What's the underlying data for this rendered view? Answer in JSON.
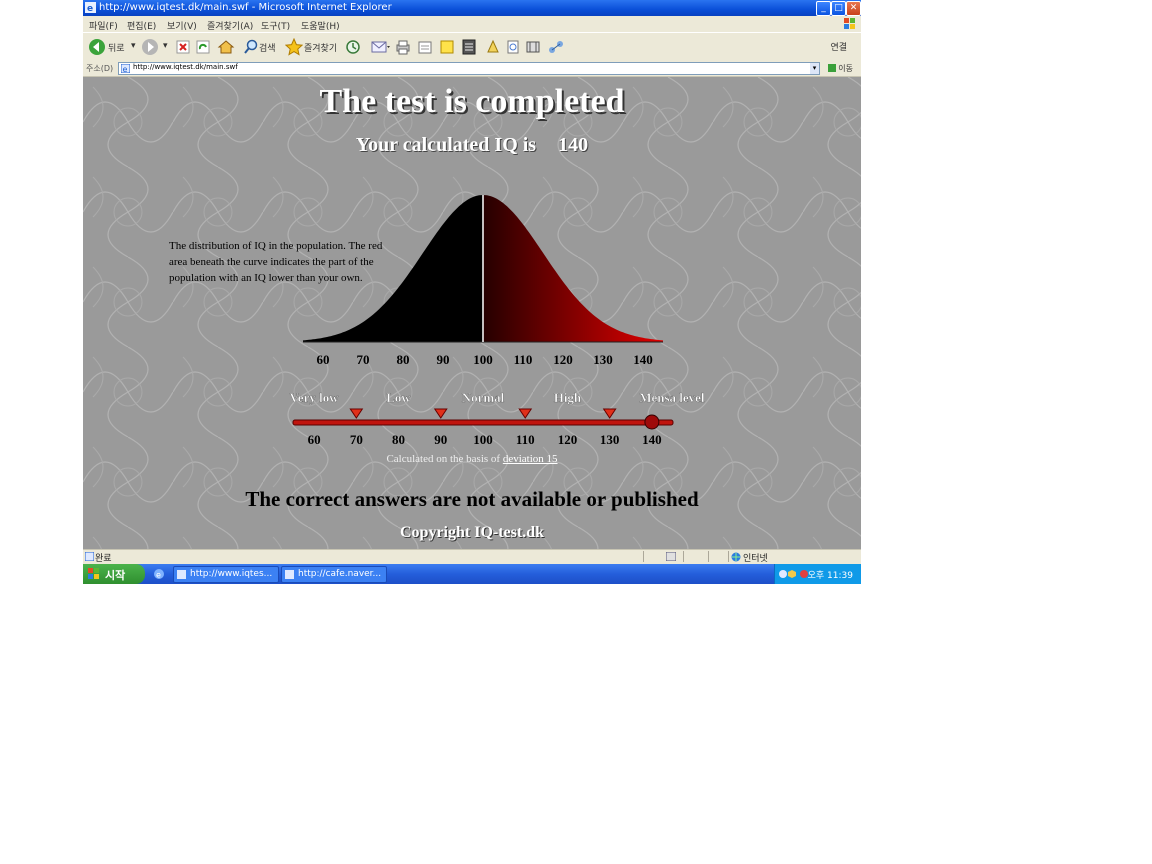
{
  "window": {
    "title": "http://www.iqtest.dk/main.swf - Microsoft Internet Explorer",
    "controls": [
      "_",
      "□",
      "✕"
    ]
  },
  "menu": [
    "파일(F)",
    "편집(E)",
    "보기(V)",
    "즐겨찾기(A)",
    "도구(T)",
    "도움말(H)"
  ],
  "toolbar": {
    "back_label": "뒤로",
    "search_label": "검색",
    "favorites_label": "즐겨찾기",
    "links_label": "연결"
  },
  "address": {
    "label": "주소(D)",
    "url": "http://www.iqtest.dk/main.swf",
    "go_label": "이동"
  },
  "page": {
    "heading": "The test is completed",
    "iq_prefix": "Your calculated IQ is",
    "iq_value": "140",
    "distribution_text": "The distribution of IQ in the population. The red area beneath the curve indicates the part of the population with an IQ lower than your own.",
    "basis_text": "Calculated on the basis of",
    "basis_link": "deviation 15",
    "answers_text": "The correct answers are not available or published",
    "copyright": "Copyright IQ-test.dk"
  },
  "chart_data": {
    "type": "area",
    "x": [
      60,
      70,
      80,
      90,
      100,
      110,
      120,
      130,
      140
    ],
    "tick_labels": [
      "60",
      "70",
      "80",
      "90",
      "100",
      "110",
      "120",
      "130",
      "140"
    ],
    "mean": 100,
    "deviation": 15,
    "user_iq": 140,
    "xlim": [
      55,
      145
    ]
  },
  "scale": {
    "levels": [
      "Very low",
      "Low",
      "Normal",
      "High",
      "Mensa level"
    ],
    "ticks": [
      "60",
      "70",
      "80",
      "90",
      "100",
      "110",
      "120",
      "130",
      "140"
    ],
    "tick_values": [
      60,
      70,
      80,
      90,
      100,
      110,
      120,
      130,
      140
    ],
    "boundaries": [
      70,
      90,
      110,
      130
    ],
    "marker_value": 140,
    "colors": {
      "bar": "#c0140e",
      "marker": "#9e0a0a",
      "triangle": "#e0301a"
    }
  },
  "status": {
    "left": "완료",
    "zone": "인터넷"
  },
  "taskbar": {
    "start_label": "시작",
    "tasks": [
      "http://www.iqtes...",
      "http://cafe.naver..."
    ],
    "time": "오후 11:39"
  }
}
